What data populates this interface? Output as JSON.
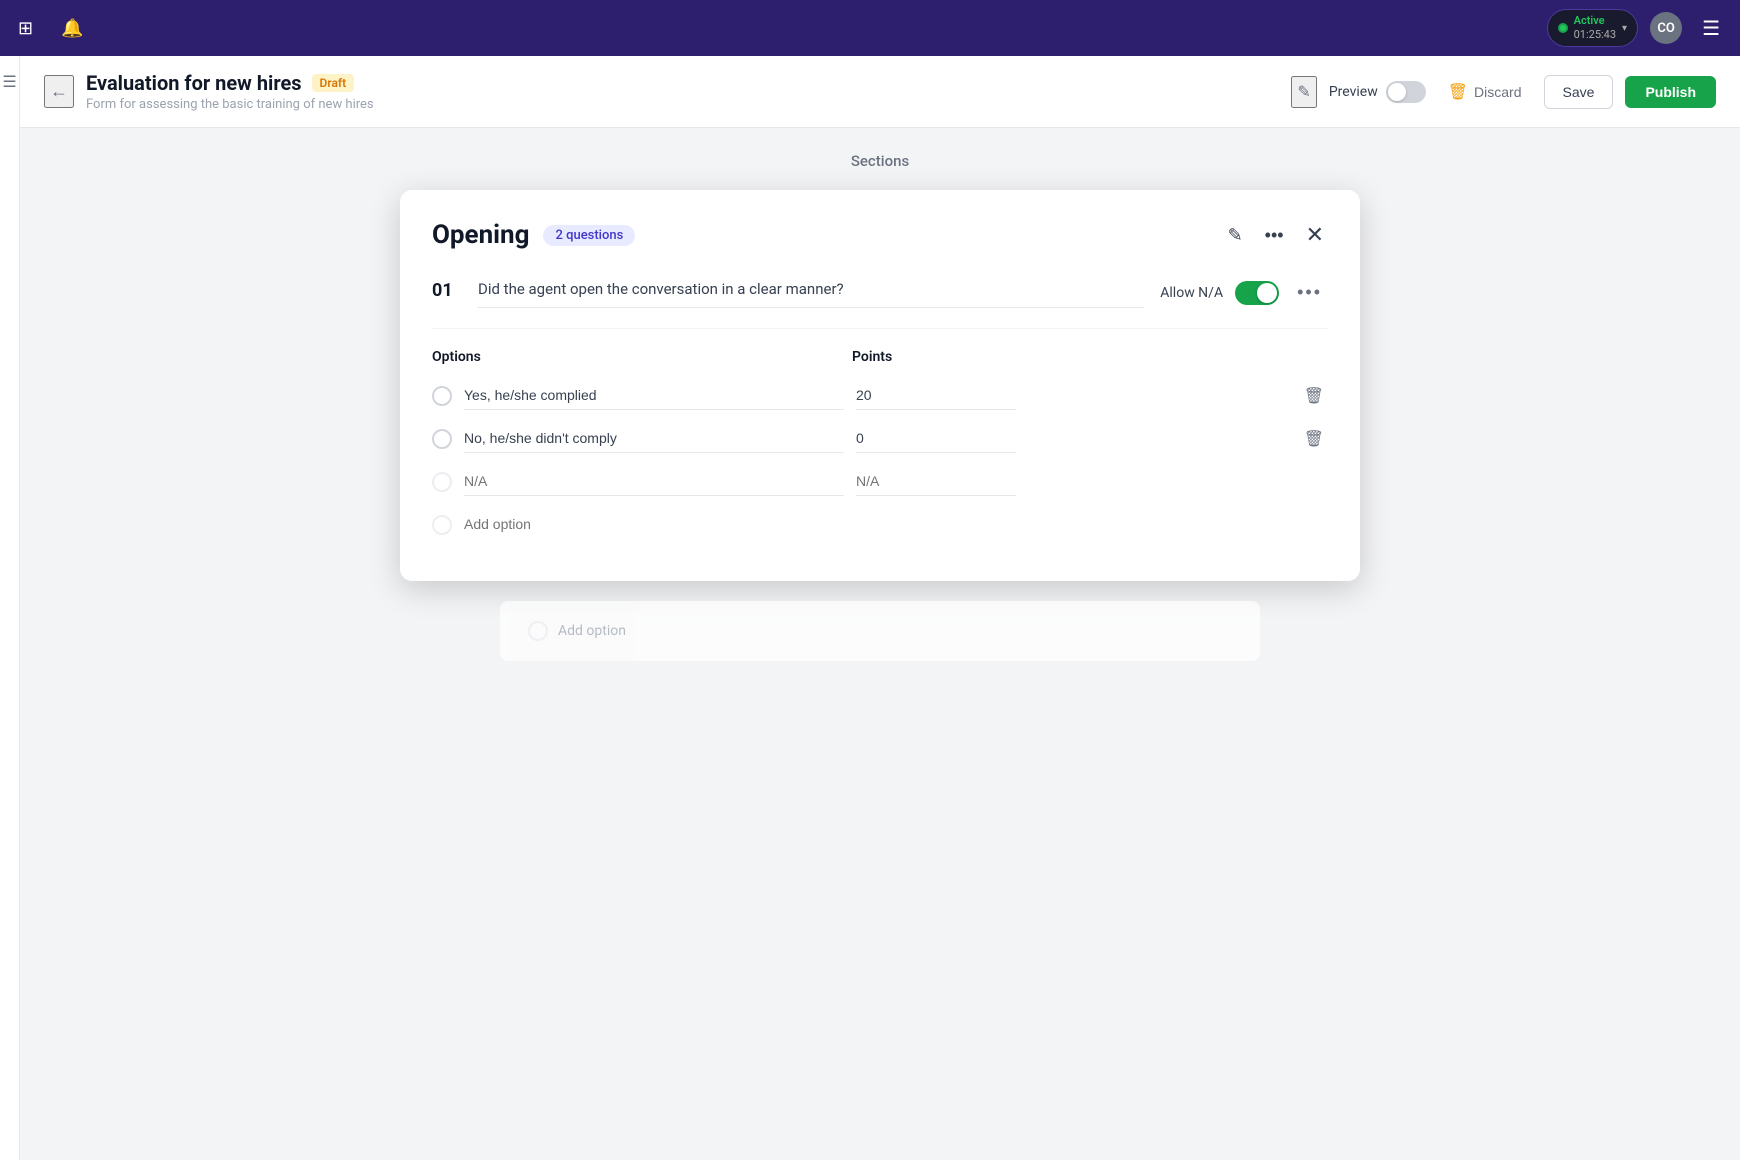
{
  "topNav": {
    "leftIcons": [
      "grid-icon",
      "bell-icon"
    ],
    "active": {
      "label": "Active",
      "time": "01:25:43"
    },
    "avatarInitials": "CO",
    "menuIcon": "menu-icon"
  },
  "header": {
    "backLabel": "←",
    "formTitle": "Evaluation for new hires",
    "draftBadge": "Draft",
    "formSubtitle": "Form for assessing the basic training of new hires",
    "editIconLabel": "✎",
    "previewLabel": "Preview",
    "discardLabel": "Discard",
    "saveLabel": "Save",
    "publishLabel": "Publish"
  },
  "main": {
    "sectionsLabel": "Sections",
    "card": {
      "sectionTitle": "Opening",
      "questionsBadge": "2 questions",
      "question": {
        "number": "01",
        "text": "Did the agent open the conversation in a clear manner?",
        "allowNA": "Allow N/A"
      },
      "options": {
        "header": {
          "optionsLabel": "Options",
          "pointsLabel": "Points"
        },
        "rows": [
          {
            "value": "Yes, he/she complied",
            "points": "20",
            "isPlaceholder": false
          },
          {
            "value": "No, he/she didn't comply",
            "points": "0",
            "isPlaceholder": false
          },
          {
            "value": "N/A",
            "points": "N/A",
            "isPlaceholder": true
          },
          {
            "value": "Add option",
            "points": "",
            "isPlaceholder": true
          }
        ]
      }
    },
    "bgCard": {
      "addOptionLabel": "Add option"
    }
  }
}
